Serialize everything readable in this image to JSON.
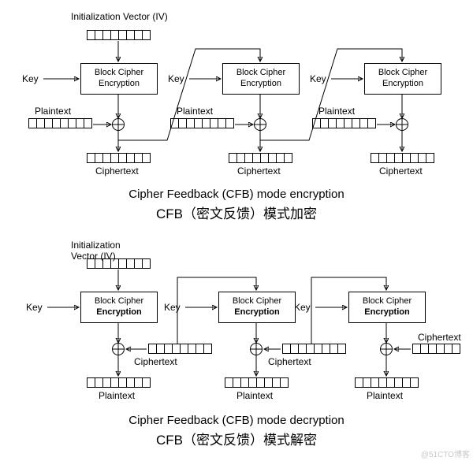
{
  "encryption": {
    "iv_label": "Initialization Vector (IV)",
    "stages": [
      {
        "key_label": "Key",
        "block_label": "Block Cipher",
        "enc_label": "Encryption",
        "plain_label": "Plaintext",
        "cipher_label": "Ciphertext"
      },
      {
        "key_label": "Key",
        "block_label": "Block Cipher",
        "enc_label": "Encryption",
        "plain_label": "Plaintext",
        "cipher_label": "Ciphertext"
      },
      {
        "key_label": "Key",
        "block_label": "Block Cipher",
        "enc_label": "Encryption",
        "plain_label": "Plaintext",
        "cipher_label": "Ciphertext"
      }
    ],
    "caption_en": "Cipher Feedback (CFB) mode encryption",
    "caption_zh": "CFB（密文反馈）模式加密"
  },
  "decryption": {
    "iv_label": "Initialization Vector (IV)",
    "stages": [
      {
        "key_label": "Key",
        "block_label": "Block Cipher",
        "enc_label": "Encryption",
        "plain_label": "Plaintext",
        "cipher_label": "Ciphertext"
      },
      {
        "key_label": "Key",
        "block_label": "Block Cipher",
        "enc_label": "Encryption",
        "plain_label": "Plaintext",
        "cipher_label": "Ciphertext"
      },
      {
        "key_label": "Key",
        "block_label": "Block Cipher",
        "enc_label": "Encryption",
        "plain_label": "Plaintext",
        "cipher_label": "Ciphertext"
      }
    ],
    "caption_en": "Cipher Feedback (CFB) mode decryption",
    "caption_zh": "CFB（密文反馈）模式解密"
  },
  "watermark": "@51CTO博客"
}
